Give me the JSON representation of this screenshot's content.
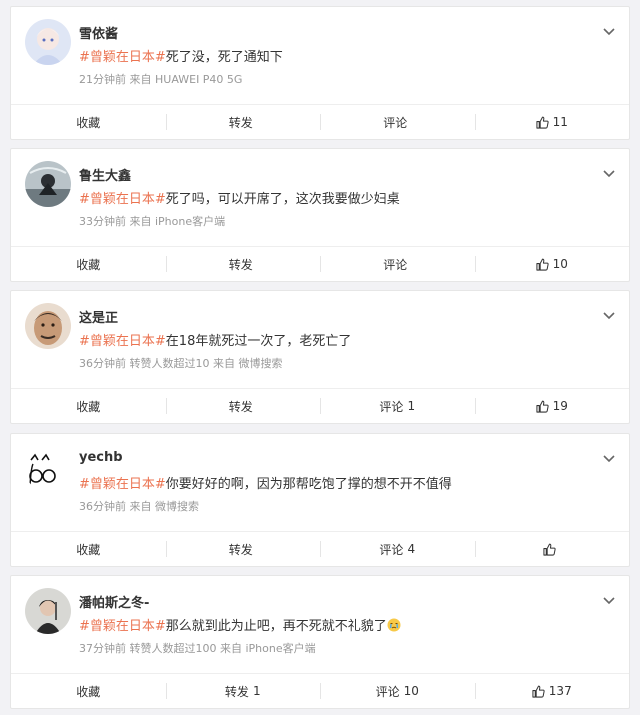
{
  "accent_color": "#eb7350",
  "posts": [
    {
      "username": "雪依酱",
      "hashtag": "#曾颖在日本#",
      "text": "死了没，死了通知下",
      "meta": "21分钟前  来自 HUAWEI P40 5G",
      "actions": {
        "collect": "收藏",
        "forward": "转发",
        "forward_count": "",
        "comment": "评论",
        "comment_count": "",
        "like_count": "11"
      }
    },
    {
      "username": "鲁生大鑫",
      "hashtag": "#曾颖在日本#",
      "text": "死了吗，可以开席了，这次我要做少妇桌",
      "meta": "33分钟前  来自 iPhone客户端",
      "actions": {
        "collect": "收藏",
        "forward": "转发",
        "forward_count": "",
        "comment": "评论",
        "comment_count": "",
        "like_count": "10"
      }
    },
    {
      "username": "这是正",
      "hashtag": "#曾颖在日本#",
      "text": "在18年就死过一次了，老死亡了",
      "meta": "36分钟前  转赞人数超过10  来自 微博搜索",
      "actions": {
        "collect": "收藏",
        "forward": "转发",
        "forward_count": "",
        "comment": "评论",
        "comment_count": "1",
        "like_count": "19"
      }
    },
    {
      "username": "yechb",
      "hashtag": "#曾颖在日本#",
      "text": "你要好好的啊，因为那帮吃饱了撑的想不开不值得",
      "meta": "36分钟前  来自 微博搜索",
      "actions": {
        "collect": "收藏",
        "forward": "转发",
        "forward_count": "",
        "comment": "评论",
        "comment_count": "4",
        "like_count": ""
      }
    },
    {
      "username": "潘帕斯之冬-",
      "hashtag": "#曾颖在日本#",
      "text": "那么就到此为止吧，再不死就不礼貌了",
      "meta": "37分钟前  转赞人数超过100  来自 iPhone客户端",
      "actions": {
        "collect": "收藏",
        "forward": "转发",
        "forward_count": "1",
        "comment": "评论",
        "comment_count": "10",
        "like_count": "137"
      }
    }
  ]
}
